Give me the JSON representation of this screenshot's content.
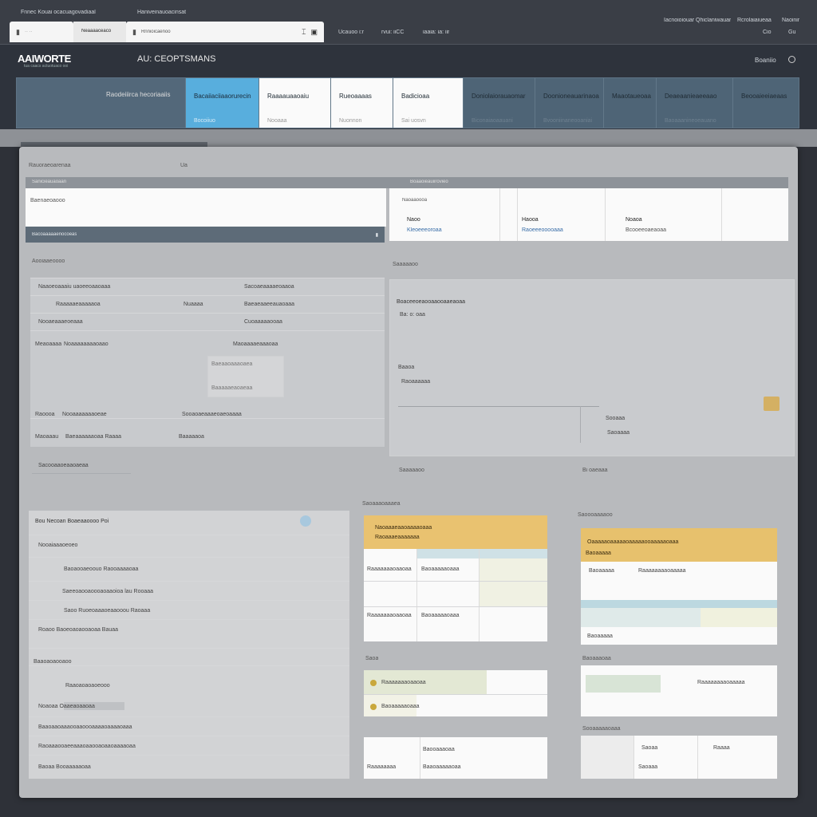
{
  "browser": {
    "top_left_label": "Fnnec Kouai ocacuagovadiaal",
    "top_mid_label": "Haniveinauoacinsat",
    "tab1_label": "Neaaaaceaco",
    "tab2_label": "Rnnioicaenoo",
    "toolbar_links": [
      "Ucauoo i:r",
      "rvui: iiCC",
      "iaaia: ia: iir"
    ],
    "right_links": [
      "Iacnoioiouar",
      "Qhiclaniwauar",
      "Rcrolaiaiueaa",
      "Naoinir"
    ],
    "right_nums": [
      "Cio",
      "Gu"
    ]
  },
  "app": {
    "logo": "AAIWORTE",
    "logo_sub": "tua caacs actuotuaco ooi",
    "title": "AU: CEOPTSMANS",
    "header_right": "Boaniio"
  },
  "nav": [
    {
      "label": "Raodeiiirca\nhecoriaaiis",
      "sub": ""
    },
    {
      "label": "Bacaiiaciiaaorurecin",
      "sub": "Bocoiiuo"
    },
    {
      "label": "Raaaauaaoaiu",
      "sub": "Nooaaa"
    },
    {
      "label": "Rueoaaaas",
      "sub": "Nuonnon"
    },
    {
      "label": "Badicioaa",
      "sub": "Sai uosvn"
    },
    {
      "label": "Doniolaiorauaomar",
      "sub": "Biconaiaoaauani"
    },
    {
      "label": "Doonioneauarinaoa",
      "sub": "Bvooniinaneooaniai"
    },
    {
      "label": "Maaotaueoaa",
      "sub": ""
    },
    {
      "label": "Deaeaanieaeeaao",
      "sub": "Baoaaanineoeauano"
    },
    {
      "label": "Beooaieeiaeaas",
      "sub": ""
    }
  ],
  "content": {
    "breadcrumb": "Rauoraeoarenaa",
    "breadcrumb_num": "Ua",
    "left_section": "Sanicieauaoaan",
    "right_section": "Boaaoieauiirovieo",
    "search_title": "Baenaeoaooo",
    "search_footer": "Bacoaaaaaenocoeas",
    "stat_cards": [
      {
        "title": "Naoo",
        "value": "Kleoeeeoroaa"
      },
      {
        "title": "Haooa",
        "value": "Raoeeeooooaaa"
      },
      {
        "title": "Noaoa",
        "value": "Bcooeeoaeaoaa"
      }
    ],
    "stat_header": "Naoaaoooa",
    "form_title": "Aooiaaeoooo",
    "form_rows": [
      [
        "Naaoeoaaaiu uaoeeoaaoaaa",
        "Sacoaeaaaaeoaaoa"
      ],
      [
        "Raaaaaeaaaaaoa",
        "Nuaaaa",
        "Baeaeaaeeauaoaaa"
      ],
      [
        "Nooaeaaaeoeaaa",
        "Cuoaaaaaooaa"
      ],
      [
        "Meaoaaaa",
        "Noaaaaaaaaoaao",
        "Maoaaaaeaaaoaa"
      ],
      [
        "Baeaaoaaaoaea",
        "Baaaaaeaoaeaa"
      ],
      [
        "Raoooa",
        "Nooaaaaaaaoeae",
        "Sooaoaeaaaeoaeoaaaa"
      ],
      [
        "Maoaaau",
        "Baeaaaaaaoaa Raaaa",
        "Baaaaaoa"
      ]
    ],
    "form_footer": "Sacooaaoeaaoaeaa",
    "chart_title": "Boaceeoeaooaaooaaeaoaa",
    "chart_sub": "Ba: o: oaa",
    "chart_label1": "Baaoa",
    "chart_label2": "Raoaaaaaa",
    "chart_label3": "Sooaaa",
    "chart_label4": "Saoaaaa",
    "chart_footer_left": "Saaaaaoo",
    "chart_footer_right": "Bi oaeaaa",
    "list_title": "Bou Necoan Boaeaaoooo Poi",
    "list_items": [
      "Nooaiaaaoeoeo",
      "Baoaooaeoouo Raooaaaaoaa",
      "Saeeoaooaoooaoaaoioa lau Rooaaa",
      "Saoo Ruoeoaaaoeaaooou Raoaaa",
      "Roaoo Baoeoaoaooaoaa Bauaa",
      "Baaoaoaooaoo",
      "Raaoaoaoaoeooo",
      "Noaoaa Oaaeaoaaoaa",
      "Baaoaaoaaaooaaoooaaaaoaaaaoaaa",
      "Raoaaaooaeeaaaoaaooaoaaoaaaaoaa",
      "Baoaa Booaaaaaoaa"
    ],
    "card_mid_section": "Saoaaaoaaaea",
    "card_mid_title": "Naoaaaeaaoaaaaoaaa",
    "card_mid_sub": "Raoaaaeaaaaaaa",
    "card_right_section": "Saoooaaaaoo",
    "card_right_title": "Oaaaaaoaaaaaoaaaaaooaaaaaoaaa",
    "card_right_sub": "Baoaaaaa",
    "small_mid_label": "Saoa",
    "small_mid_rows": [
      "Raaaaaaaoaaoaa",
      "Baoaaaaaoaaa"
    ],
    "small_right_label": "Baoaaaoaa",
    "small_right_text": "Raaaaaaaaoaaaaa",
    "bottom_mid_rows": [
      "Baooaaaoaa",
      "Raaaaaaaa",
      "Baaoaaaaaoaa"
    ],
    "bottom_right_label": "Sooaaaaaoaaa",
    "bottom_right_rows": [
      "Saoaa",
      "Raaaa",
      "Saoaaa"
    ]
  }
}
